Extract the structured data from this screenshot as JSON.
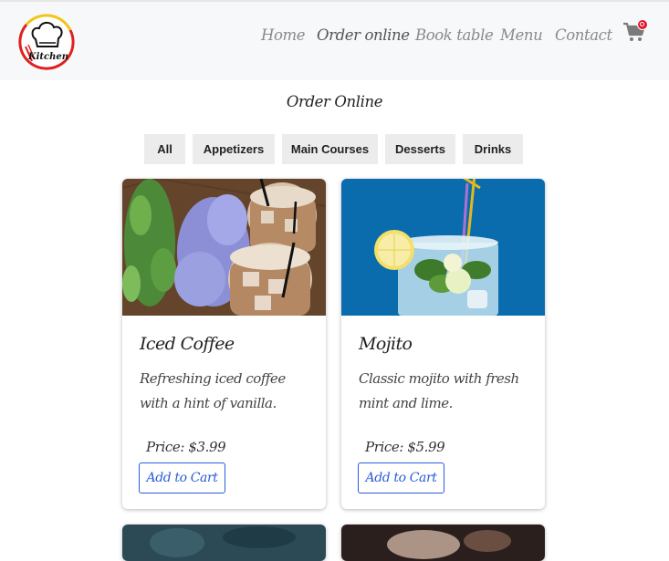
{
  "header": {
    "logo_text": "Kitchen",
    "nav": [
      "Home",
      "Order online",
      "Book table",
      "Menu",
      "Contact"
    ],
    "active_nav": "Order online"
  },
  "page": {
    "title": "Order Online"
  },
  "filters": [
    "All",
    "Appetizers",
    "Main Courses",
    "Desserts",
    "Drinks"
  ],
  "items": [
    {
      "title": "Iced Coffee",
      "description": "Refreshing iced coffee with a hint of vanilla.",
      "price": "Price: $3.99",
      "button": "Add to Cart"
    },
    {
      "title": "Mojito",
      "description": "Classic mojito with fresh mint and lime.",
      "price": "Price: $5.99",
      "button": "Add to Cart"
    }
  ],
  "colors": {
    "header_bg": "#f7f8f9",
    "nav_text": "#8a8a8a",
    "accent": "#2a5bd7",
    "badge": "#e0162b",
    "filter_bg": "#ececec"
  },
  "icons": [
    "chef-hat-logo",
    "cart-icon",
    "cart-badge"
  ]
}
